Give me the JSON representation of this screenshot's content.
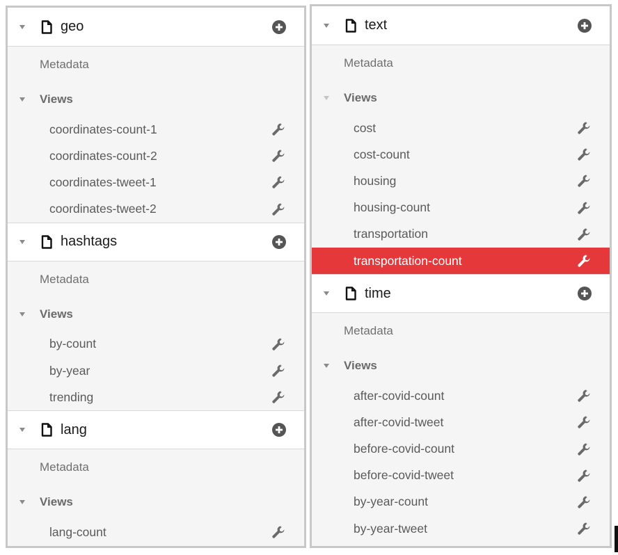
{
  "left_column": {
    "sections": [
      {
        "title": "geo",
        "metadata_label": "Metadata",
        "views_label": "Views",
        "views": [
          "coordinates-count-1",
          "coordinates-count-2",
          "coordinates-tweet-1",
          "coordinates-tweet-2"
        ]
      },
      {
        "title": "hashtags",
        "metadata_label": "Metadata",
        "views_label": "Views",
        "views": [
          "by-count",
          "by-year",
          "trending"
        ]
      },
      {
        "title": "lang",
        "metadata_label": "Metadata",
        "views_label": "Views",
        "views": [
          "lang-count"
        ]
      }
    ]
  },
  "right_column": {
    "sections": [
      {
        "title": "text",
        "metadata_label": "Metadata",
        "views_label": "Views",
        "views": [
          "cost",
          "cost-count",
          "housing",
          "housing-count",
          "transportation",
          "transportation-count"
        ],
        "active_view": "transportation-count"
      },
      {
        "title": "time",
        "metadata_label": "Metadata",
        "views_label": "Views",
        "views": [
          "after-covid-count",
          "after-covid-tweet",
          "before-covid-count",
          "before-covid-tweet",
          "by-year-count",
          "by-year-tweet"
        ]
      }
    ]
  },
  "icons": {
    "caret": "caret-down-icon",
    "file": "file-icon",
    "add": "plus-circle-icon",
    "edit": "wrench-icon"
  },
  "colors": {
    "active_row": "#e5383b",
    "panel_bg": "#f5f5f5",
    "header_bg": "#ffffff",
    "border": "#c8c8c8"
  }
}
